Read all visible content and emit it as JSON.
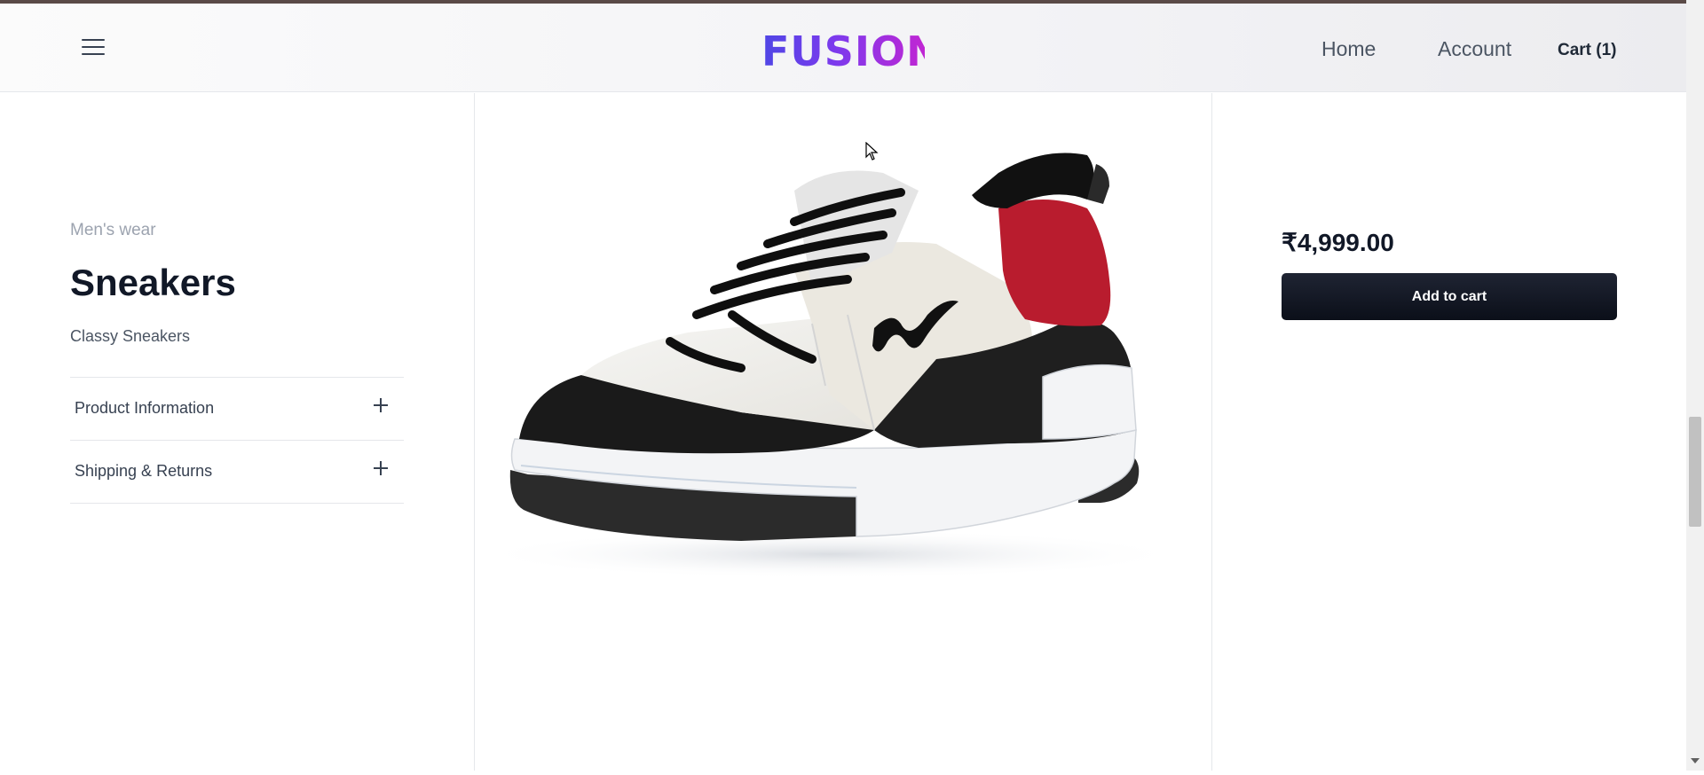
{
  "header": {
    "brand": "FUSION",
    "nav": {
      "home": "Home",
      "account": "Account",
      "cart": "Cart (1)"
    }
  },
  "product": {
    "category": "Men's wear",
    "title": "Sneakers",
    "subtitle": "Classy Sneakers",
    "price": "₹4,999.00",
    "add_to_cart_label": "Add to cart",
    "accordion": [
      {
        "label": "Product Information"
      },
      {
        "label": "Shipping & Returns"
      }
    ]
  },
  "icons": {
    "menu": "hamburger-icon",
    "expand": "plus-icon",
    "cursor": "mouse-pointer-icon"
  },
  "colors": {
    "brand_gradient_start": "#4f46e5",
    "brand_gradient_end": "#c026d3",
    "button_bg": "#0b0f19",
    "shoe_accent": "#b91c2e"
  }
}
